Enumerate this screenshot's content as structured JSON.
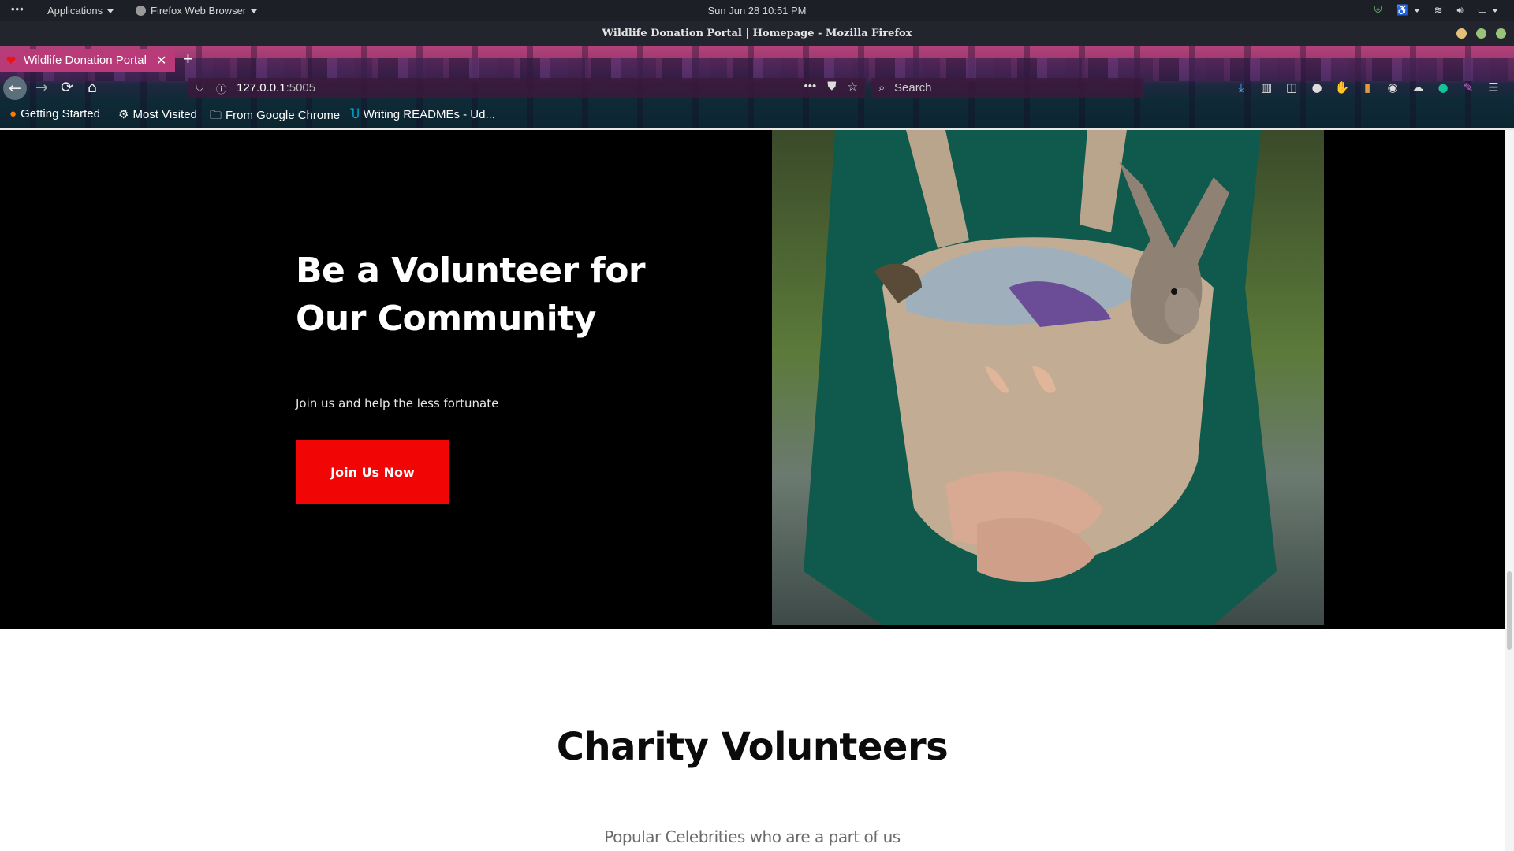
{
  "system_bar": {
    "activities": "•••",
    "applications": "Applications",
    "app_name": "Firefox Web Browser",
    "clock": "Sun Jun 28  10:51 PM"
  },
  "window": {
    "title": "Wildlife Donation Portal | Homepage - Mozilla Firefox"
  },
  "browser": {
    "tab_title": "Wildlife Donation Portal",
    "new_tab": "+",
    "url_host": "127.0.0.1",
    "url_port": ":5005",
    "search_placeholder": "Search",
    "bookmarks": [
      {
        "label": "Getting Started"
      },
      {
        "label": "Most Visited"
      },
      {
        "label": "From Google Chrome"
      },
      {
        "label": "Writing READMEs - Ud..."
      }
    ]
  },
  "hero": {
    "heading": "Be a Volunteer for Our Community",
    "subtext": "Join us and help the less fortunate",
    "cta_label": "Join Us Now",
    "cta_color": "#f20505"
  },
  "section": {
    "heading": "Charity Volunteers",
    "subheading": "Popular Celebrities who are a part of us"
  }
}
